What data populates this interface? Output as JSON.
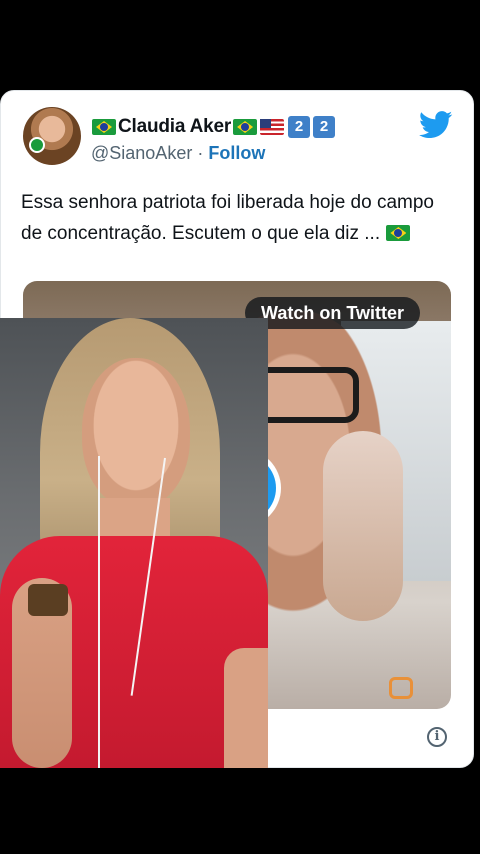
{
  "tweet": {
    "author_name": "Claudia Aker",
    "badges": [
      "2",
      "2"
    ],
    "handle": "@SianoAker",
    "separator": "·",
    "follow_label": "Follow",
    "text": "Essa senhora patriota foi liberada hoje do campo de concentração. Escutem o que ela diz ...",
    "media": {
      "watch_label": "Watch on Twitter"
    },
    "info_icon": "i"
  },
  "icons": {
    "brand": "twitter-bird-icon",
    "play": "play-icon",
    "info": "info-icon",
    "flags": [
      "brazil-flag-icon",
      "usa-flag-icon"
    ]
  },
  "colors": {
    "twitter_blue": "#1d9bf0",
    "follow_blue": "#1d74b8",
    "badge_blue": "#3f80c8",
    "text_dark": "#0f1419",
    "text_gray": "#536471",
    "reaction_shirt": "#e2243a"
  }
}
